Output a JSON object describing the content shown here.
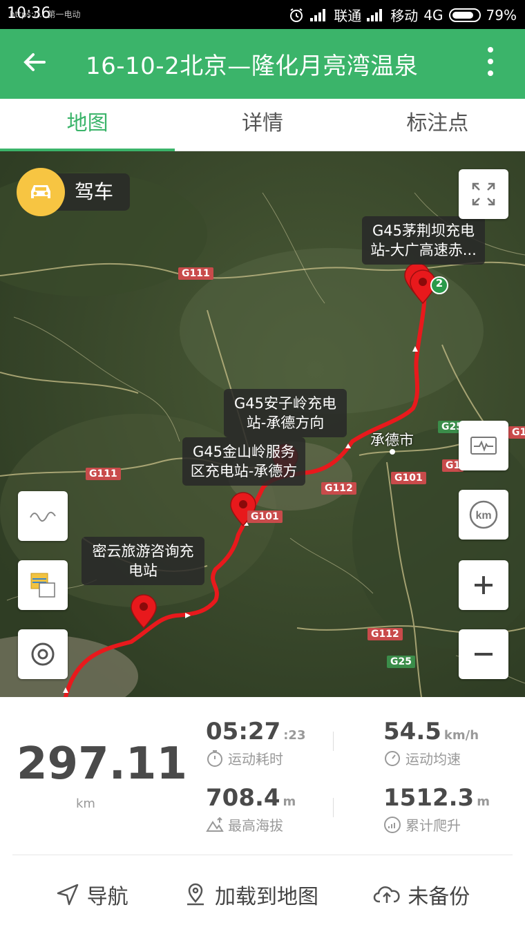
{
  "status_bar": {
    "time": "10:36",
    "overlay_text": "https://...第一电动",
    "carrier1": "联通",
    "carrier2": "移动",
    "network": "4G",
    "battery": "79%"
  },
  "app_bar": {
    "title": "16-10-2北京—隆化月亮湾温泉"
  },
  "tabs": [
    {
      "label": "地图",
      "active": true
    },
    {
      "label": "详情",
      "active": false
    },
    {
      "label": "标注点",
      "active": false
    }
  ],
  "map": {
    "mode_label": "驾车",
    "callouts": [
      "G45茅荆坝充电站-大广高速赤...",
      "G45安子岭充电站-承德方向",
      "G45金山岭服务区充电站-承德方",
      "密云旅游咨询充电站"
    ],
    "callout_lines": [
      [
        "G45茅荆坝充电",
        "站-大广高速赤..."
      ],
      [
        "G45安子岭充电",
        "站-承德方向"
      ],
      [
        "G45金山岭服务",
        "区充电站-承德方"
      ],
      [
        "密云旅游咨询充",
        "电站"
      ]
    ],
    "waypoint_badge": "2",
    "city_label": "承德市",
    "road_labels": [
      "G111",
      "G111",
      "G101",
      "G112",
      "G101",
      "G112",
      "G25",
      "G25",
      "G10",
      "G1"
    ],
    "route_color": "#e8191c"
  },
  "stats": {
    "distance": "297.11",
    "distance_unit": "km",
    "duration": "05:27",
    "duration_seconds": ":23",
    "duration_label": "运动耗时",
    "avg_speed": "54.5",
    "avg_speed_unit": "km/h",
    "avg_speed_label": "运动均速",
    "max_altitude": "708.4",
    "max_altitude_unit": "m",
    "max_altitude_label": "最高海拔",
    "total_climb": "1512.3",
    "total_climb_unit": "m",
    "total_climb_label": "累计爬升"
  },
  "actions": [
    {
      "label": "导航",
      "icon": "navigation-arrow-icon"
    },
    {
      "label": "加载到地图",
      "icon": "map-pin-icon"
    },
    {
      "label": "未备份",
      "icon": "cloud-upload-icon"
    }
  ],
  "colors": {
    "accent": "#3bb46a",
    "route": "#e8191c",
    "callout_bg": "#282828"
  }
}
